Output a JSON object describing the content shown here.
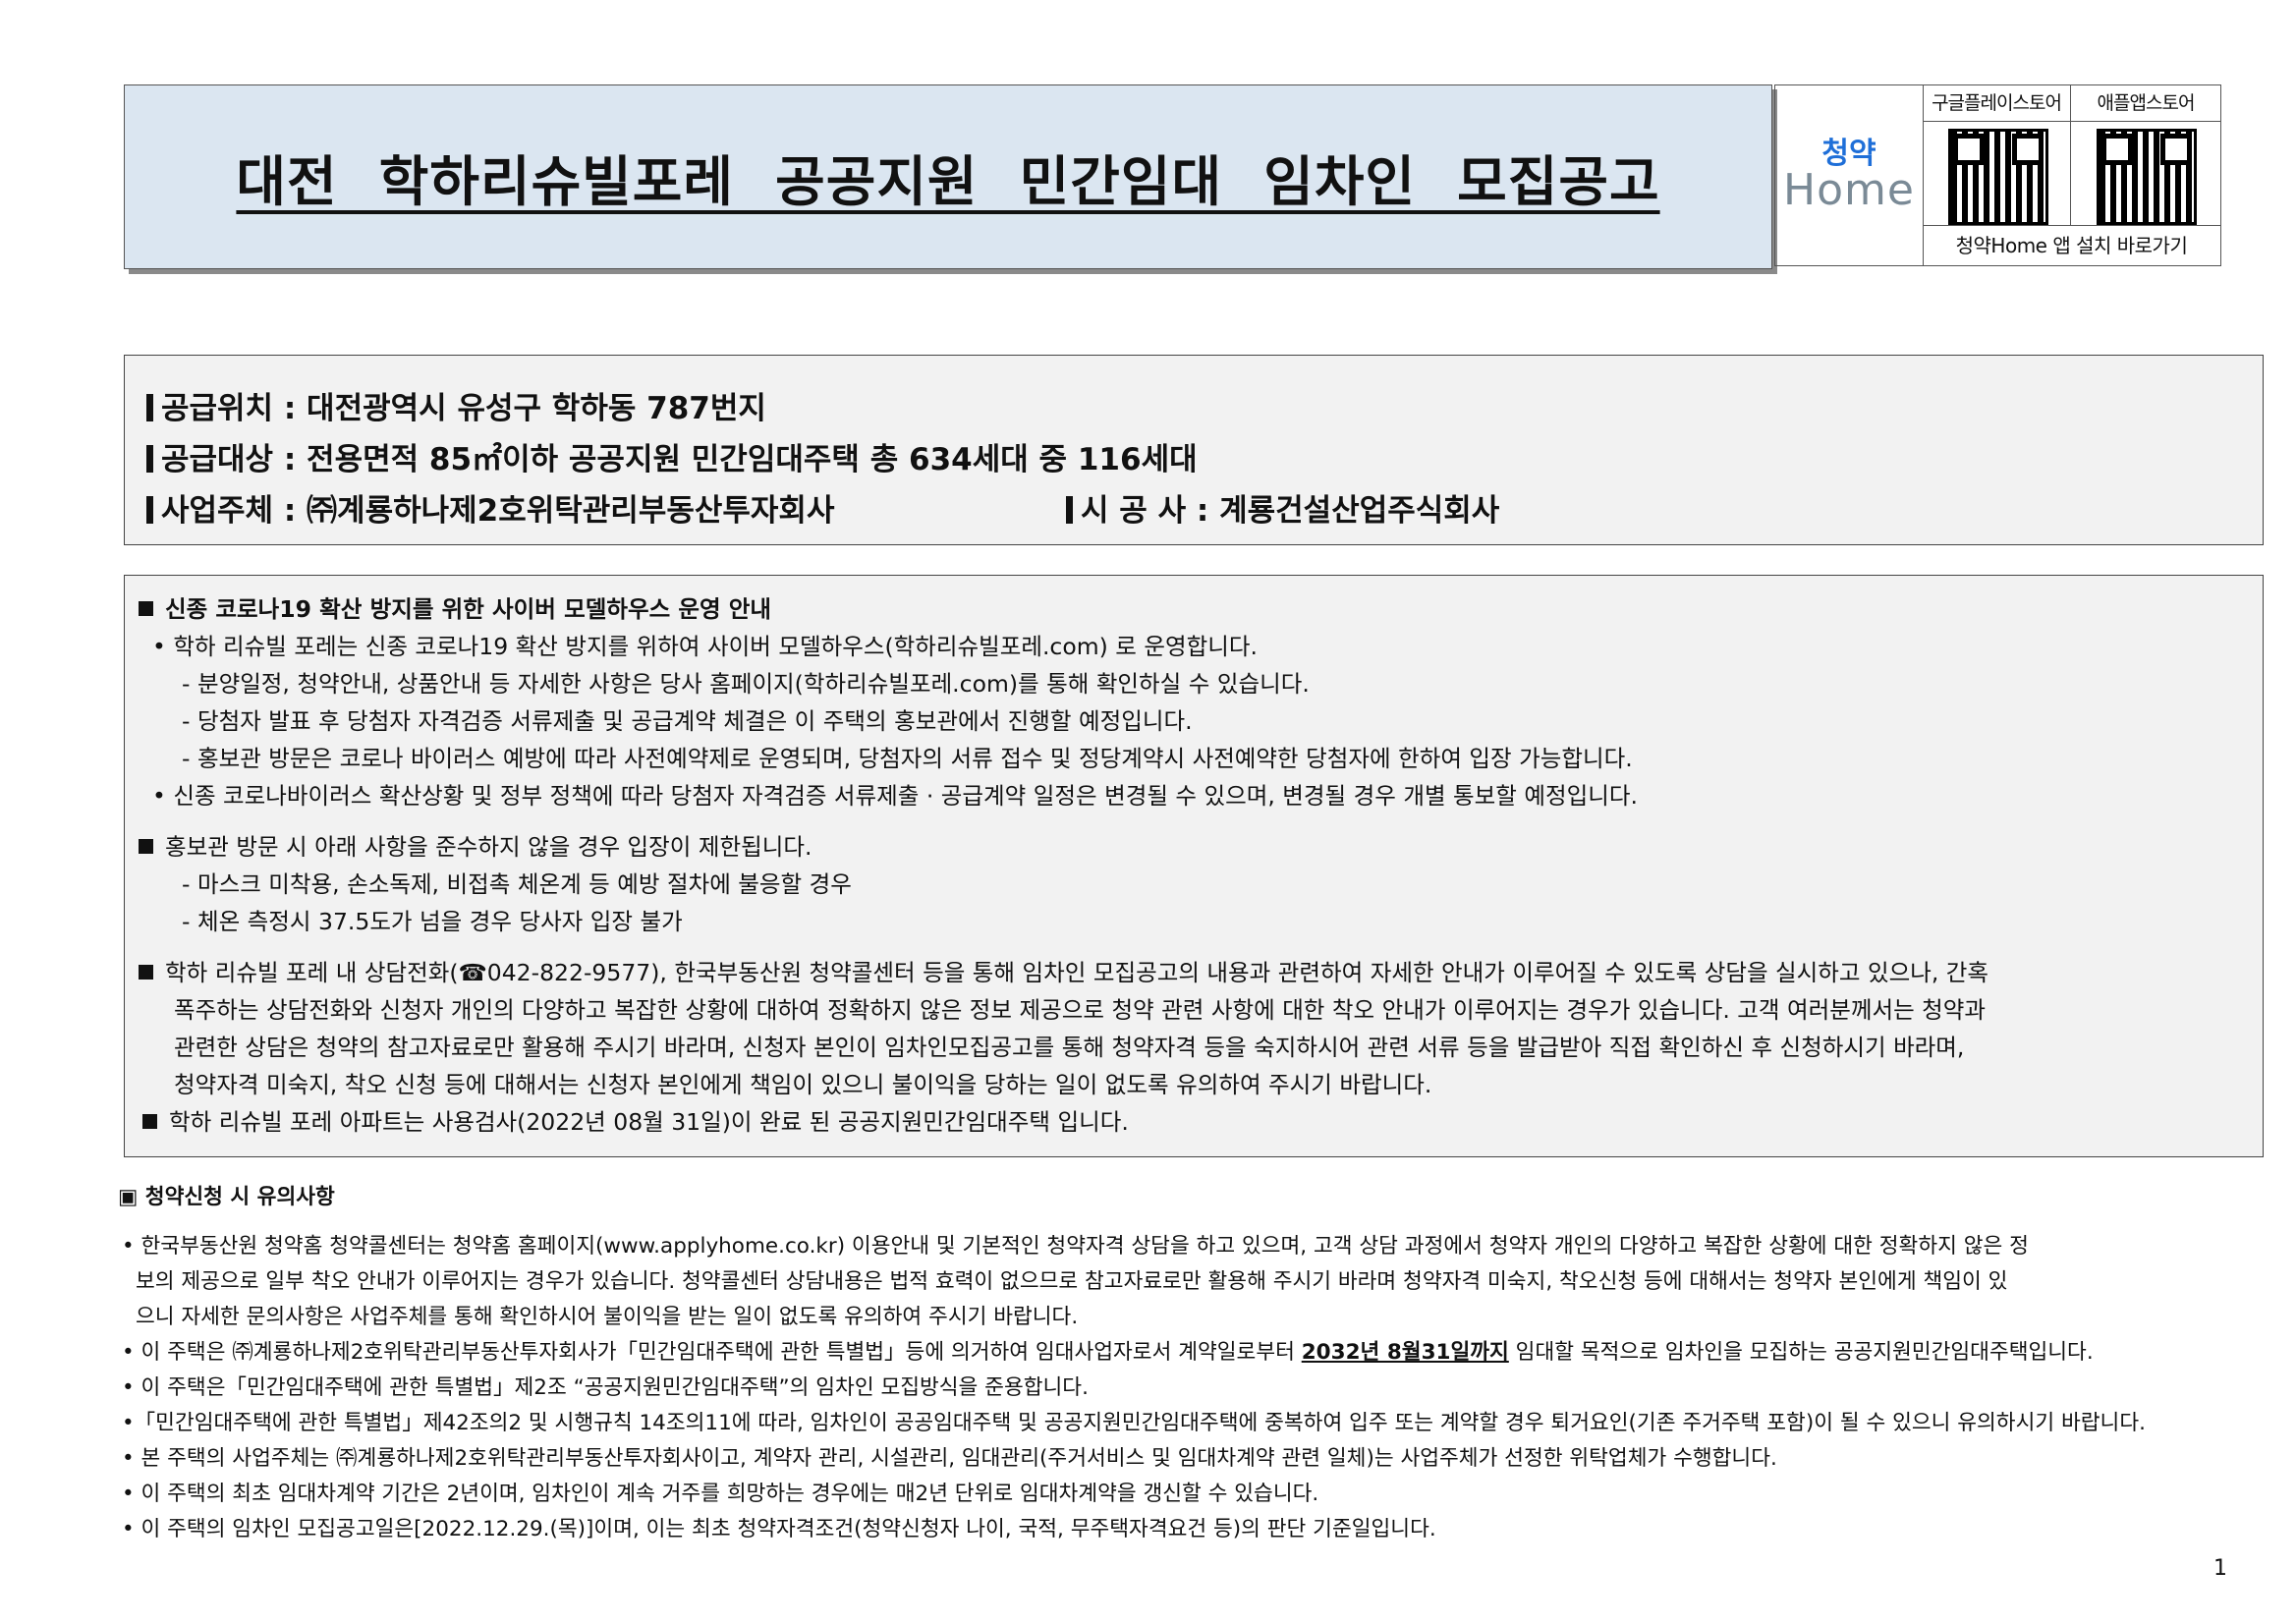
{
  "header": {
    "title": "대전 학하리슈빌포레 공공지원 민간임대 임차인 모집공고",
    "logo_top": "청약",
    "logo_bottom": "Home",
    "google_store": "구글플레이스토어",
    "apple_store": "애플앱스토어",
    "app_link": "청약Home 앱 설치 바로가기"
  },
  "info": {
    "location": "공급위치 : 대전광역시 유성구 학하동 787번지",
    "target": "공급대상 : 전용면적 85㎡이하 공공지원 민간임대주택 총 634세대 중 116세대",
    "operator": "사업주체 : ㈜계룡하나제2호위탁관리부동산투자회사",
    "constructor": "시 공 사 : 계룡건설산업주식회사"
  },
  "notice": {
    "h1": "신종 코로나19 확산 방지를 위한 사이버 모델하우스 운영 안내",
    "l1": "• 학하 리슈빌 포레는 신종 코로나19 확산 방지를 위하여 사이버 모델하우스(학하리슈빌포레.com) 로 운영합니다.",
    "l2": "- 분양일정, 청약안내, 상품안내 등 자세한 사항은 당사 홈페이지(학하리슈빌포레.com)를 통해 확인하실 수 있습니다.",
    "l3": "- 당첨자 발표 후 당첨자 자격검증 서류제출 및 공급계약 체결은 이 주택의 홍보관에서 진행할 예정입니다.",
    "l4": "- 홍보관 방문은 코로나 바이러스 예방에 따라 사전예약제로 운영되며, 당첨자의 서류 접수 및 정당계약시 사전예약한 당첨자에 한하여 입장 가능합니다.",
    "l5": "• 신종 코로나바이러스 확산상황 및 정부 정책에 따라 당첨자 자격검증 서류제출 · 공급계약 일정은 변경될 수 있으며, 변경될 경우 개별 통보할 예정입니다.",
    "h2": "홍보관 방문 시 아래 사항을 준수하지 않을 경우 입장이 제한됩니다.",
    "l6": "- 마스크 미착용, 손소독제, 비접촉 체온계 등 예방 절차에 불응할 경우",
    "l7": "- 체온 측정시 37.5도가 넘을 경우 당사자 입장 불가",
    "h3": "학하 리슈빌 포레 내 상담전화(☎042-822-9577), 한국부동산원 청약콜센터 등을 통해 임차인 모집공고의 내용과 관련하여 자세한 안내가 이루어질 수 있도록 상담을 실시하고 있으나, 간혹",
    "l8": "폭주하는 상담전화와 신청자 개인의 다양하고 복잡한 상황에 대하여 정확하지 않은 정보 제공으로 청약 관련 사항에 대한 착오 안내가 이루어지는 경우가 있습니다. 고객 여러분께서는 청약과",
    "l9": "관련한 상담은 청약의 참고자료로만 활용해 주시기 바라며, 신청자 본인이 임차인모집공고를 통해 청약자격 등을 숙지하시어 관련 서류 등을 발급받아 직접 확인하신 후 신청하시기 바라며,",
    "l10": "청약자격 미숙지, 착오 신청 등에 대해서는 신청자 본인에게 책임이 있으니 불이익을 당하는 일이 없도록 유의하여 주시기 바랍니다.",
    "h4": "학하 리슈빌 포레 아파트는 사용검사(2022년 08월 31일)이 완료 된 공공지원민간임대주택 입니다."
  },
  "caution": {
    "heading": "▣  청약신청 시 유의사항",
    "b1a": "• 한국부동산원 청약홈 청약콜센터는 청약홈 홈페이지(www.applyhome.co.kr) 이용안내 및 기본적인 청약자격 상담을 하고 있으며, 고객 상담 과정에서 청약자 개인의 다양하고 복잡한 상황에 대한 정확하지 않은 정",
    "b1b": "보의 제공으로 일부 착오 안내가 이루어지는 경우가 있습니다. 청약콜센터 상담내용은 법적 효력이 없으므로 참고자료로만 활용해 주시기 바라며 청약자격 미숙지, 착오신청 등에 대해서는 청약자 본인에게 책임이 있",
    "b1c": "으니 자세한 문의사항은 사업주체를 통해 확인하시어 불이익을 받는 일이 없도록 유의하여 주시기 바랍니다.",
    "b2_pre": "• 이 주택은 ㈜계룡하나제2호위탁관리부동산투자회사가「민간임대주택에 관한 특별법」등에 의거하여 임대사업자로서 계약일로부터 ",
    "b2_em": "2032년 8월31일까지",
    "b2_post": " 임대할 목적으로 임차인을 모집하는 공공지원민간임대주택입니다.",
    "b3": "• 이 주택은「민간임대주택에 관한 특별법」제2조 “공공지원민간임대주택”의 임차인 모집방식을 준용합니다.",
    "b4": "•「민간임대주택에 관한 특별법」제42조의2 및 시행규칙 14조의11에 따라, 임차인이 공공임대주택 및 공공지원민간임대주택에 중복하여 입주 또는 계약할 경우 퇴거요인(기존 주거주택 포함)이 될 수 있으니 유의하시기 바랍니다.",
    "b5": "• 본 주택의 사업주체는 ㈜계룡하나제2호위탁관리부동산투자회사이고, 계약자 관리, 시설관리, 임대관리(주거서비스 및 임대차계약 관련 일체)는 사업주체가 선정한 위탁업체가 수행합니다.",
    "b6": "• 이 주택의 최초 임대차계약 기간은 2년이며, 임차인이 계속 거주를 희망하는 경우에는 매2년 단위로 임대차계약을 갱신할 수 있습니다.",
    "b7": "• 이 주택의 임차인 모집공고일은[2022.12.29.(목)]이며, 이는 최초 청약자격조건(청약신청자 나이, 국적, 무주택자격요건 등)의 판단 기준일입니다."
  },
  "page_number": "1"
}
